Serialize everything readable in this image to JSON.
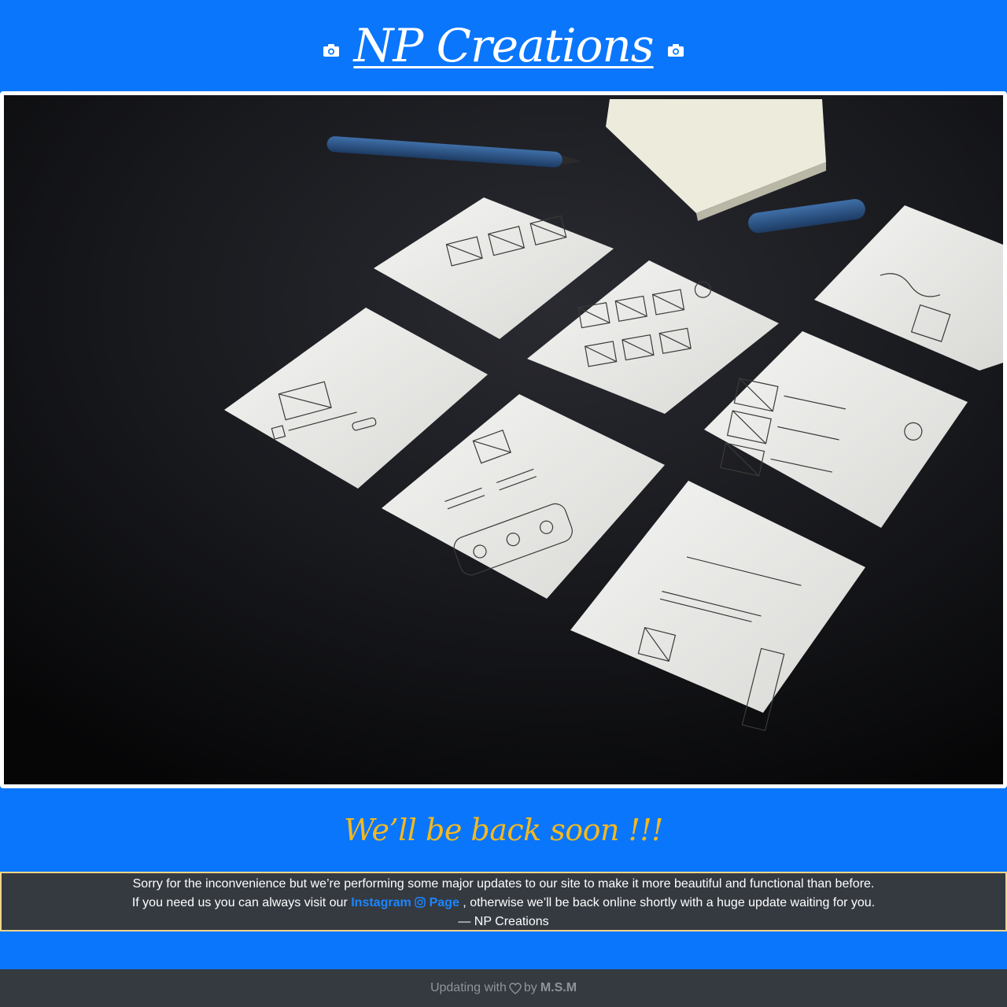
{
  "header": {
    "title": "NP Creations",
    "left_icon": "camera-icon",
    "right_icon": "camera-icon"
  },
  "hero": {
    "image": "sticky-note-wireframes-photo"
  },
  "notice": {
    "heading": "We’ll be back soon !!!",
    "line1": "Sorry for the inconvenience but we’re performing some major updates to our site to make it more beautiful and functional than before.",
    "line2_prefix": "If you need us you can always visit our",
    "link_word1": "Instagram",
    "link_word2": "Page",
    "line2_suffix": ", otherwise we’ll be back online shortly with a huge update waiting for you.",
    "signature": "— NP Creations"
  },
  "footer": {
    "prefix": "Updating with",
    "by": "by",
    "author": "M.S.M"
  },
  "colors": {
    "background": "#0a76fc",
    "heading": "#f4b91e",
    "panel": "#353a41",
    "link": "#1b86ff",
    "border": "#f3d48a"
  }
}
